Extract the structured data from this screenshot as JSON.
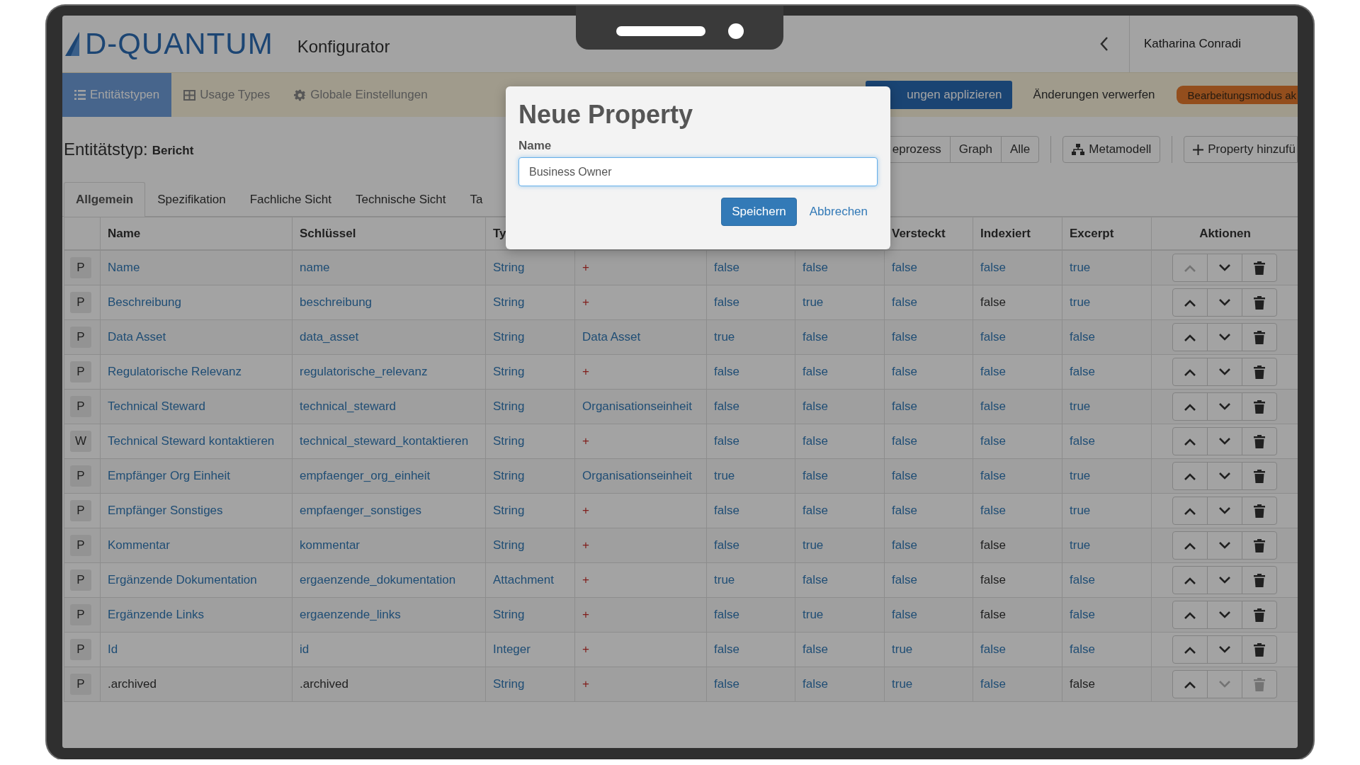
{
  "header": {
    "logo": "D-QUANTUM",
    "app_title": "Konfigurator",
    "user": "Katharina Conradi"
  },
  "nav": {
    "items": [
      {
        "label": "Entitätstypen",
        "selected": true
      },
      {
        "label": "Usage Types",
        "selected": false
      },
      {
        "label": "Globale Einstellungen",
        "selected": false
      }
    ],
    "actions": [
      {
        "label": "ungen applizieren",
        "kind": "primary"
      },
      {
        "label": "Änderungen verwerfen",
        "kind": "plain"
      },
      {
        "label": "Bearbeitungsmodus ak",
        "kind": "warning"
      }
    ]
  },
  "entity": {
    "label": "Entitätstyp:",
    "name": "Bericht"
  },
  "view_buttons": [
    "eprozess",
    "Graph",
    "Alle"
  ],
  "tool_buttons": [
    "Metamodell",
    "Property hinzufü"
  ],
  "tabs": [
    {
      "label": "Allgemein",
      "selected": true
    },
    {
      "label": "Spezifikation",
      "selected": false
    },
    {
      "label": "Fachliche Sicht",
      "selected": false
    },
    {
      "label": "Technische Sicht",
      "selected": false
    },
    {
      "label": "Ta",
      "selected": false
    }
  ],
  "table": {
    "columns": {
      "name": "Name",
      "key": "Schlüssel",
      "type": "Ty",
      "hidden": "Versteckt",
      "indexed": "Indexiert",
      "excerpt": "Excerpt",
      "actions": "Aktionen"
    },
    "rows": [
      {
        "badge": "P",
        "can_move_up": false,
        "can_move_down": true,
        "can_delete": true,
        "cells": [
          {
            "text": "Name",
            "link": true
          },
          {
            "text": "name",
            "link": true
          },
          {
            "text": "String",
            "link": true
          },
          {
            "text": "+",
            "link": true,
            "kind": "add"
          },
          {
            "text": "false",
            "link": true
          },
          {
            "text": "false",
            "link": true
          },
          {
            "text": "false",
            "link": true
          },
          {
            "text": "false",
            "link": true
          },
          {
            "text": "true",
            "link": true
          }
        ]
      },
      {
        "badge": "P",
        "can_move_up": true,
        "can_move_down": true,
        "can_delete": true,
        "cells": [
          {
            "text": "Beschreibung",
            "link": true
          },
          {
            "text": "beschreibung",
            "link": true
          },
          {
            "text": "String",
            "link": true
          },
          {
            "text": "+",
            "link": true,
            "kind": "add"
          },
          {
            "text": "false",
            "link": true
          },
          {
            "text": "true",
            "link": true
          },
          {
            "text": "false",
            "link": true
          },
          {
            "text": "false",
            "link": false
          },
          {
            "text": "true",
            "link": true
          }
        ]
      },
      {
        "badge": "P",
        "can_move_up": true,
        "can_move_down": true,
        "can_delete": true,
        "cells": [
          {
            "text": "Data Asset",
            "link": true
          },
          {
            "text": "data_asset",
            "link": true
          },
          {
            "text": "String",
            "link": true
          },
          {
            "text": "Data Asset",
            "link": true
          },
          {
            "text": "true",
            "link": true
          },
          {
            "text": "false",
            "link": true
          },
          {
            "text": "false",
            "link": true
          },
          {
            "text": "false",
            "link": true
          },
          {
            "text": "false",
            "link": true
          }
        ]
      },
      {
        "badge": "P",
        "can_move_up": true,
        "can_move_down": true,
        "can_delete": true,
        "cells": [
          {
            "text": "Regulatorische Relevanz",
            "link": true
          },
          {
            "text": "regulatorische_relevanz",
            "link": true
          },
          {
            "text": "String",
            "link": true
          },
          {
            "text": "+",
            "link": true,
            "kind": "add"
          },
          {
            "text": "false",
            "link": true
          },
          {
            "text": "false",
            "link": true
          },
          {
            "text": "false",
            "link": true
          },
          {
            "text": "false",
            "link": true
          },
          {
            "text": "false",
            "link": true
          }
        ]
      },
      {
        "badge": "P",
        "can_move_up": true,
        "can_move_down": true,
        "can_delete": true,
        "cells": [
          {
            "text": "Technical Steward",
            "link": true
          },
          {
            "text": "technical_steward",
            "link": true
          },
          {
            "text": "String",
            "link": true
          },
          {
            "text": "Organisationseinheit",
            "link": true
          },
          {
            "text": "false",
            "link": true
          },
          {
            "text": "false",
            "link": true
          },
          {
            "text": "false",
            "link": true
          },
          {
            "text": "false",
            "link": true
          },
          {
            "text": "true",
            "link": true
          }
        ]
      },
      {
        "badge": "W",
        "can_move_up": true,
        "can_move_down": true,
        "can_delete": true,
        "cells": [
          {
            "text": "Technical Steward kontaktieren",
            "link": true
          },
          {
            "text": "technical_steward_kontaktieren",
            "link": true
          },
          {
            "text": "String",
            "link": true
          },
          {
            "text": "+",
            "link": true,
            "kind": "add"
          },
          {
            "text": "false",
            "link": true
          },
          {
            "text": "false",
            "link": true
          },
          {
            "text": "false",
            "link": true
          },
          {
            "text": "false",
            "link": true
          },
          {
            "text": "false",
            "link": true
          }
        ]
      },
      {
        "badge": "P",
        "can_move_up": true,
        "can_move_down": true,
        "can_delete": true,
        "cells": [
          {
            "text": "Empfänger Org Einheit",
            "link": true
          },
          {
            "text": "empfaenger_org_einheit",
            "link": true
          },
          {
            "text": "String",
            "link": true
          },
          {
            "text": "Organisationseinheit",
            "link": true
          },
          {
            "text": "true",
            "link": true
          },
          {
            "text": "false",
            "link": true
          },
          {
            "text": "false",
            "link": true
          },
          {
            "text": "false",
            "link": true
          },
          {
            "text": "true",
            "link": true
          }
        ]
      },
      {
        "badge": "P",
        "can_move_up": true,
        "can_move_down": true,
        "can_delete": true,
        "cells": [
          {
            "text": "Empfänger Sonstiges",
            "link": true
          },
          {
            "text": "empfaenger_sonstiges",
            "link": true
          },
          {
            "text": "String",
            "link": true
          },
          {
            "text": "+",
            "link": true,
            "kind": "add"
          },
          {
            "text": "false",
            "link": true
          },
          {
            "text": "false",
            "link": true
          },
          {
            "text": "false",
            "link": true
          },
          {
            "text": "false",
            "link": true
          },
          {
            "text": "true",
            "link": true
          }
        ]
      },
      {
        "badge": "P",
        "can_move_up": true,
        "can_move_down": true,
        "can_delete": true,
        "cells": [
          {
            "text": "Kommentar",
            "link": true
          },
          {
            "text": "kommentar",
            "link": true
          },
          {
            "text": "String",
            "link": true
          },
          {
            "text": "+",
            "link": true,
            "kind": "add"
          },
          {
            "text": "false",
            "link": true
          },
          {
            "text": "true",
            "link": true
          },
          {
            "text": "false",
            "link": true
          },
          {
            "text": "false",
            "link": false
          },
          {
            "text": "true",
            "link": true
          }
        ]
      },
      {
        "badge": "P",
        "can_move_up": true,
        "can_move_down": true,
        "can_delete": true,
        "cells": [
          {
            "text": "Ergänzende Dokumentation",
            "link": true
          },
          {
            "text": "ergaenzende_dokumentation",
            "link": true
          },
          {
            "text": "Attachment",
            "link": true
          },
          {
            "text": "+",
            "link": true,
            "kind": "add"
          },
          {
            "text": "true",
            "link": true
          },
          {
            "text": "false",
            "link": true
          },
          {
            "text": "false",
            "link": true
          },
          {
            "text": "false",
            "link": false
          },
          {
            "text": "false",
            "link": true
          }
        ]
      },
      {
        "badge": "P",
        "can_move_up": true,
        "can_move_down": true,
        "can_delete": true,
        "cells": [
          {
            "text": "Ergänzende Links",
            "link": true
          },
          {
            "text": "ergaenzende_links",
            "link": true
          },
          {
            "text": "String",
            "link": true
          },
          {
            "text": "+",
            "link": true,
            "kind": "add"
          },
          {
            "text": "false",
            "link": true
          },
          {
            "text": "true",
            "link": true
          },
          {
            "text": "false",
            "link": true
          },
          {
            "text": "false",
            "link": false
          },
          {
            "text": "false",
            "link": true
          }
        ]
      },
      {
        "badge": "P",
        "can_move_up": true,
        "can_move_down": true,
        "can_delete": true,
        "cells": [
          {
            "text": "Id",
            "link": true
          },
          {
            "text": "id",
            "link": true
          },
          {
            "text": "Integer",
            "link": true
          },
          {
            "text": "+",
            "link": true,
            "kind": "add"
          },
          {
            "text": "false",
            "link": true
          },
          {
            "text": "false",
            "link": true
          },
          {
            "text": "true",
            "link": true
          },
          {
            "text": "false",
            "link": true
          },
          {
            "text": "false",
            "link": true
          }
        ]
      },
      {
        "badge": "P",
        "can_move_up": true,
        "can_move_down": false,
        "can_delete": false,
        "cells": [
          {
            "text": ".archived",
            "link": false
          },
          {
            "text": ".archived",
            "link": false
          },
          {
            "text": "String",
            "link": true
          },
          {
            "text": "+",
            "link": true,
            "kind": "add"
          },
          {
            "text": "false",
            "link": true
          },
          {
            "text": "false",
            "link": true
          },
          {
            "text": "true",
            "link": true
          },
          {
            "text": "false",
            "link": true
          },
          {
            "text": "false",
            "link": false
          }
        ]
      }
    ]
  },
  "dialog": {
    "title": "Neue Property",
    "field_label": "Name",
    "value": "Business Owner",
    "buttons": [
      {
        "label": "Speichern",
        "kind": "primary"
      },
      {
        "label": "Abbrechen",
        "kind": "link"
      }
    ]
  }
}
